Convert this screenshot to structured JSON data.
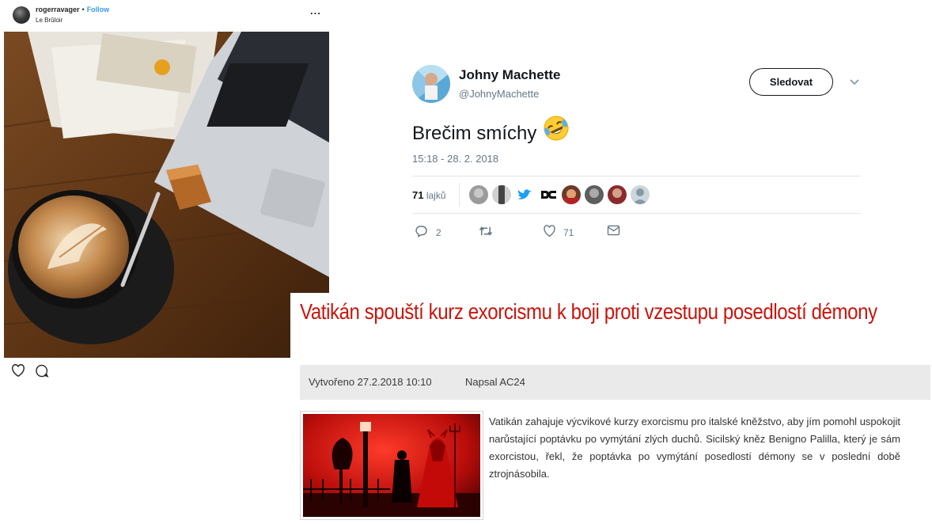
{
  "instagram": {
    "username": "rogerravager",
    "separator": "•",
    "follow_label": "Follow",
    "location": "Le Brûloir",
    "more_label": "...",
    "icons": [
      "heart-icon",
      "comment-icon"
    ]
  },
  "tweet": {
    "display_name": "Johny Machette",
    "handle": "@JohnyMachette",
    "follow_label": "Sledovat",
    "text": "Brečim smíchy",
    "emoji_icon": "rolling-on-floor-laughing-emoji",
    "timestamp": "15:18 - 28. 2. 2018",
    "likes_count": "71",
    "likes_label": "lajků",
    "reply_count": "2",
    "retweet_count": "",
    "like_count": "71",
    "colors": {
      "text": "#14171a",
      "muted": "#657786",
      "divider": "#e1e8ed",
      "twitter_blue": "#1da1f2"
    }
  },
  "article": {
    "title": "Vatikán spouští kurz exorcismu k boji proti vzestupu posedlostí démony",
    "created": "Vytvořeno 27.2.2018 10:10",
    "author": "Napsal AC24",
    "body": "Vatikán zahajuje výcvikové kurzy exorcismu pro italské kněžstvo, aby jím pomohl uspokojit narůstající poptávku po vymýtání zlých duchů. Sicilský kněz Benigno Palilla, který je sám exorcistou, řekl, že poptávka po vymýtání posedlostí démony se v poslední době ztrojnásobila.",
    "colors": {
      "title": "#c8150c",
      "meta_bg": "#eaeaea"
    }
  }
}
